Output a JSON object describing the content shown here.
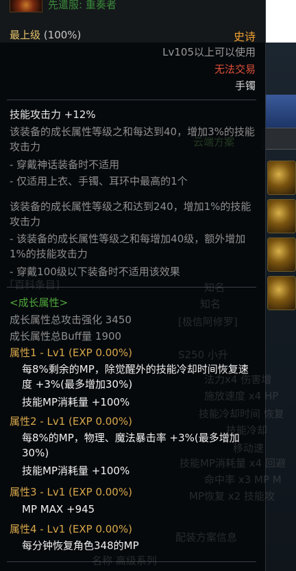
{
  "background": {
    "ghost_texts": [
      "「百科条目]",
      "知名",
      "知名",
      "[极信阿修罗]",
      "S250 小升",
      "法力x4 伤害增",
      "施放速度 x4 HP",
      "技能冷却时间 恢复",
      "技能冷却",
      "移动速",
      "技能MP消耗量 x4 回避",
      "命中率 x3 MP M",
      "MP恢复 x2 技能攻",
      "配装方案信息",
      "名称 高级系列"
    ],
    "tab_text": "云端方案"
  },
  "tooltip": {
    "item_name": "先遣服: 重奏者",
    "grade_label": "最上级",
    "grade_pct": "(100%)",
    "rarity": "史诗",
    "level_req": "Lv105以上可以使用",
    "trade": "无法交易",
    "slot_type": "手镯",
    "skill_attack": {
      "title": "技能攻击力  +12%",
      "lines": [
        "该装备的成长属性等级之和每达到40，增加3%的技能攻击力",
        "- 穿戴神话装备时不适用",
        "- 仅适用上衣、手镯、耳环中最高的1个"
      ],
      "extra": [
        "该装备的成长属性等级之和达到240，增加1%的技能攻击力",
        "- 该装备的成长属性等级之和每增加40级，额外增加1%的技能攻击力",
        "- 穿戴100级以下装备时不适用该效果"
      ]
    },
    "growth": {
      "header": "<成长属性>",
      "total_attack": "成长属性总攻击强化 3450",
      "total_buff": "成长属性总Buff量 1900",
      "attrs": [
        {
          "title": "属性1 - Lv1 (EXP 0.00%)",
          "lines": [
            "每8%剩余的MP，除觉醒外的技能冷却时间恢复速度 +3%(最多增加30%)",
            "技能MP消耗量 +100%"
          ]
        },
        {
          "title": "属性2 - Lv1 (EXP 0.00%)",
          "lines": [
            "每8%的MP，物理、魔法暴击率 +3%(最多增加30%)",
            "技能MP消耗量 +100%"
          ]
        },
        {
          "title": "属性3 - Lv1 (EXP 0.00%)",
          "lines": [
            "MP MAX +945"
          ]
        },
        {
          "title": "属性4 - Lv1 (EXP 0.00%)",
          "lines": [
            "每分钟恢复角色348的MP"
          ]
        }
      ]
    }
  },
  "colors": {
    "grade": "#e6c36b",
    "rarity_epic": "#f0a030",
    "untradeable": "#e0503a",
    "growth_green": "#4fa83c",
    "attr_gold": "#d8a84a"
  }
}
